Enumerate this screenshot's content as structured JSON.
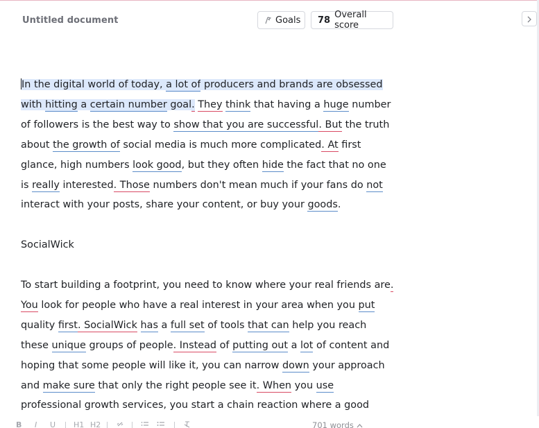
{
  "document": {
    "title": "Untitled document"
  },
  "header": {
    "goals_label": "Goals",
    "score_value": "78",
    "score_label": "Overall score",
    "panel_toggle_icon": "chevron-right-icon"
  },
  "editor": {
    "paragraph1": {
      "lines": [
        [
          {
            "t": "In the digital world of today, ",
            "sel": true
          },
          {
            "t": "a lot of",
            "sel": true,
            "u": "blue"
          },
          {
            "t": " producers and brands are obsessed",
            "sel": true
          }
        ],
        [
          {
            "t": "with ",
            "sel": true
          },
          {
            "t": "hitting",
            "sel": true,
            "u": "blue"
          },
          {
            "t": " a ",
            "sel": true
          },
          {
            "t": "certain number",
            "sel": true,
            "u": "blue"
          },
          {
            "t": " goal",
            "sel": true
          },
          {
            "t": ".",
            "sel": true,
            "u": "red"
          },
          {
            "t": " "
          },
          {
            "t": "They",
            "u": "red"
          },
          {
            "t": " "
          },
          {
            "t": "think",
            "u": "blue"
          },
          {
            "t": " that having a "
          },
          {
            "t": "huge",
            "u": "blue"
          },
          {
            "t": " number"
          }
        ],
        [
          {
            "t": "of followers is the best way to "
          },
          {
            "t": "show that you are successful",
            "u": "blue"
          },
          {
            "t": ". But",
            "u": "red"
          },
          {
            "t": " the truth"
          }
        ],
        [
          {
            "t": "about "
          },
          {
            "t": "the growth of",
            "u": "blue"
          },
          {
            "t": " social media is much more complicated"
          },
          {
            "t": ". At",
            "u": "red"
          },
          {
            "t": " first"
          }
        ],
        [
          {
            "t": "glance, high numbers "
          },
          {
            "t": "look good",
            "u": "blue"
          },
          {
            "t": ", but they often "
          },
          {
            "t": "hide",
            "u": "blue"
          },
          {
            "t": " the fact that no one"
          }
        ],
        [
          {
            "t": "is "
          },
          {
            "t": "really",
            "u": "blue"
          },
          {
            "t": " interested"
          },
          {
            "t": ". Those",
            "u": "red"
          },
          {
            "t": " numbers don't mean much if your fans do "
          },
          {
            "t": "not",
            "u": "blue"
          }
        ],
        [
          {
            "t": "interact with your posts, share your content, or buy your "
          },
          {
            "t": "goods",
            "u": "blue"
          },
          {
            "t": "."
          }
        ]
      ]
    },
    "heading": "SocialWick",
    "paragraph2": {
      "lines": [
        [
          {
            "t": "To start building a footprint, you need to know where your real friends are"
          },
          {
            "t": ".",
            "u": "red"
          }
        ],
        [
          {
            "t": "You",
            "u": "red"
          },
          {
            "t": " look for people who have a real interest in your area when you "
          },
          {
            "t": "put",
            "u": "blue"
          }
        ],
        [
          {
            "t": "quality "
          },
          {
            "t": "first",
            "u": "blue"
          },
          {
            "t": ". SocialWick",
            "u": "red"
          },
          {
            "t": " "
          },
          {
            "t": "has",
            "u": "blue"
          },
          {
            "t": " a "
          },
          {
            "t": "full set",
            "u": "blue"
          },
          {
            "t": " of tools "
          },
          {
            "t": "that can",
            "u": "blue"
          },
          {
            "t": " help you reach"
          }
        ],
        [
          {
            "t": "these "
          },
          {
            "t": "unique",
            "u": "blue"
          },
          {
            "t": " groups of people"
          },
          {
            "t": ". Instead",
            "u": "red"
          },
          {
            "t": " of "
          },
          {
            "t": "putting out",
            "u": "blue"
          },
          {
            "t": " a "
          },
          {
            "t": "lot",
            "u": "blue"
          },
          {
            "t": " of content and"
          }
        ],
        [
          {
            "t": "hoping that some people will like it, you can narrow "
          },
          {
            "t": "down",
            "u": "blue"
          },
          {
            "t": " your approach"
          }
        ],
        [
          {
            "t": "and "
          },
          {
            "t": "make sure",
            "u": "blue"
          },
          {
            "t": " that only the right people see it"
          },
          {
            "t": ". When",
            "u": "red"
          },
          {
            "t": " you "
          },
          {
            "t": "use",
            "u": "blue"
          }
        ],
        [
          {
            "t": "professional growth services, you start a chain reaction where a good"
          }
        ]
      ]
    }
  },
  "toolbar": {
    "bold": "B",
    "italic": "I",
    "underline": "U",
    "h1": "H1",
    "h2": "H2",
    "link_icon": "link-icon",
    "ordered_list_icon": "ordered-list-icon",
    "bullet_list_icon": "bullet-list-icon",
    "clear_format_icon": "clear-format-icon",
    "word_count": "701 words",
    "word_count_icon": "chevron-up-icon"
  },
  "colors": {
    "selection": "#dce8fb",
    "underline_blue": "#5b8cc9",
    "underline_red": "#d94a63",
    "title_gray": "#6d6f77"
  }
}
